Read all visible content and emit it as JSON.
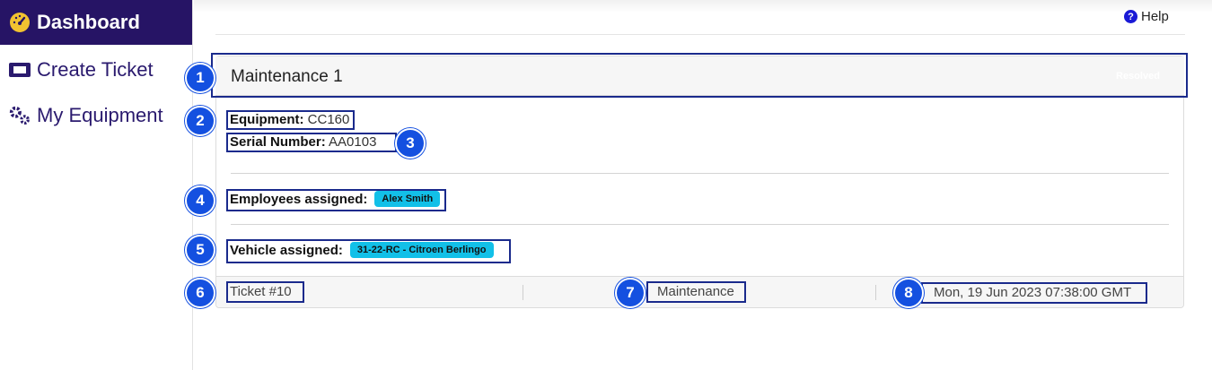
{
  "sidebar": {
    "items": [
      {
        "label": "Dashboard",
        "icon": "speedometer-icon"
      },
      {
        "label": "Create Ticket",
        "icon": "ticket-icon"
      },
      {
        "label": "My Equipment",
        "icon": "gears-icon"
      }
    ]
  },
  "header": {
    "help_label": "Help"
  },
  "ticket": {
    "title": "Maintenance 1",
    "status": "Resolved",
    "equipment_label": "Equipment:",
    "equipment_value": "CC160",
    "serial_label": "Serial Number:",
    "serial_value": "AA0103",
    "employees_label": "Employees assigned:",
    "employees": [
      "Alex Smith"
    ],
    "vehicle_label": "Vehicle assigned:",
    "vehicle": "31-22-RC - Citroen Berlingo",
    "number": "Ticket #10",
    "category": "Maintenance",
    "date": "Mon, 19 Jun 2023 07:38:00 GMT"
  },
  "markers": [
    "1",
    "2",
    "3",
    "4",
    "5",
    "6",
    "7",
    "8"
  ],
  "colors": {
    "sidebar_active": "#261465",
    "accent": "#1a2a8c",
    "badge": "#12c0e8",
    "marker": "#1450e0"
  }
}
